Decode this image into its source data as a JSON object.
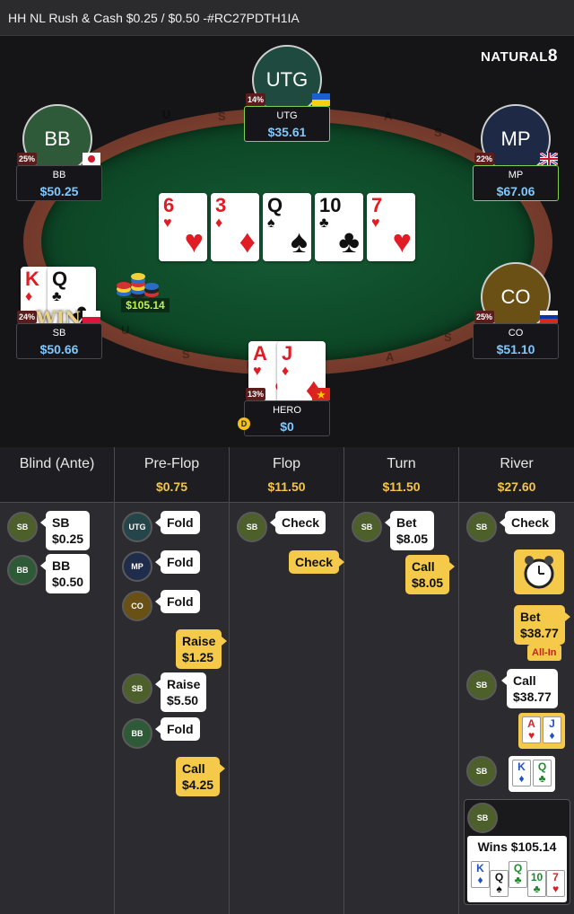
{
  "window": {
    "title": "HH NL Rush & Cash $0.25 / $0.50 -#RC27PDTH1IA"
  },
  "brand": {
    "logo": "NATURAL",
    "logo_digit": "8"
  },
  "board": {
    "cards": [
      {
        "rank": "6",
        "suit": "♥",
        "color": "red"
      },
      {
        "rank": "3",
        "suit": "♦",
        "color": "red"
      },
      {
        "rank": "Q",
        "suit": "♠",
        "color": "black"
      },
      {
        "rank": "10",
        "suit": "♣",
        "color": "black"
      },
      {
        "rank": "7",
        "suit": "♥",
        "color": "red"
      }
    ],
    "pot": "$105.14",
    "rail_letters": [
      "U",
      "S",
      "A",
      "S",
      "U",
      "S",
      "A",
      "S",
      "U"
    ]
  },
  "seats": {
    "utg": {
      "avatar": "UTG",
      "name": "UTG",
      "stack": "$35.61",
      "pct": "14%",
      "flag": "Ukraine",
      "avatar_color": "#1f4a3f"
    },
    "bb": {
      "avatar": "BB",
      "name": "BB",
      "stack": "$50.25",
      "pct": "25%",
      "flag": "Japan",
      "avatar_color": "#2e5a3a"
    },
    "mp": {
      "avatar": "MP",
      "name": "MP",
      "stack": "$67.06",
      "pct": "22%",
      "flag": "United Kingdom",
      "avatar_color": "#1e2a45"
    },
    "sb": {
      "name": "SB",
      "stack": "$50.66",
      "pct": "24%",
      "flag": "Poland",
      "win": "WIN",
      "cards": [
        {
          "rank": "K",
          "suit": "♦",
          "color": "red"
        },
        {
          "rank": "Q",
          "suit": "♣",
          "color": "black"
        }
      ]
    },
    "co": {
      "avatar": "CO",
      "name": "CO",
      "stack": "$51.10",
      "pct": "25%",
      "flag": "Russia",
      "avatar_color": "#6a5014"
    },
    "hero": {
      "name": "HERO",
      "stack": "$0",
      "pct": "13%",
      "flag": "Vietnam",
      "dealer": "D",
      "cards": [
        {
          "rank": "A",
          "suit": "♥",
          "color": "red"
        },
        {
          "rank": "J",
          "suit": "♦",
          "color": "red"
        }
      ]
    }
  },
  "streets": [
    {
      "name": "Blind (Ante)",
      "pot": ""
    },
    {
      "name": "Pre-Flop",
      "pot": "$0.75"
    },
    {
      "name": "Flop",
      "pot": "$11.50"
    },
    {
      "name": "Turn",
      "pot": "$11.50"
    },
    {
      "name": "River",
      "pot": "$27.60"
    }
  ],
  "actions": {
    "blind": [
      {
        "seat": "SB",
        "text1": "SB",
        "text2": "$0.25"
      },
      {
        "seat": "BB",
        "text1": "BB",
        "text2": "$0.50"
      }
    ],
    "preflop": [
      {
        "seat": "UTG",
        "text": "Fold"
      },
      {
        "seat": "MP",
        "text": "Fold"
      },
      {
        "seat": "CO",
        "text": "Fold"
      },
      {
        "hero_text1": "Raise",
        "hero_text2": "$1.25"
      },
      {
        "seat": "SB",
        "text1": "Raise",
        "text2": "$5.50"
      },
      {
        "seat": "BB",
        "text": "Fold"
      },
      {
        "hero_text1": "Call",
        "hero_text2": "$4.25"
      }
    ],
    "flop": [
      {
        "seat": "SB",
        "text": "Check"
      },
      {
        "hero_text": "Check"
      }
    ],
    "turn": [
      {
        "seat": "SB",
        "text1": "Bet",
        "text2": "$8.05"
      },
      {
        "hero_text1": "Call",
        "hero_text2": "$8.05"
      }
    ],
    "river": {
      "sb_check": "Check",
      "hero_bet1": "Bet",
      "hero_bet2": "$38.77",
      "allin": "All-In",
      "sb_call1": "Call",
      "sb_call2": "$38.77",
      "hero_show": [
        {
          "rank": "A",
          "suit": "♥",
          "color": "red"
        },
        {
          "rank": "J",
          "suit": "♦",
          "color": "red"
        }
      ],
      "sb_show": [
        {
          "rank": "K",
          "suit": "♦",
          "color": "blue"
        },
        {
          "rank": "Q",
          "suit": "♣",
          "color": "green"
        }
      ],
      "wins": "Wins $105.14",
      "win_hand": [
        {
          "rank": "K",
          "suit": "♦",
          "color": "blue"
        },
        {
          "rank": "Q",
          "suit": "♠",
          "color": "black"
        },
        {
          "rank": "Q",
          "suit": "♣",
          "color": "green"
        },
        {
          "rank": "10",
          "suit": "♣",
          "color": "green"
        },
        {
          "rank": "7",
          "suit": "♥",
          "color": "red"
        }
      ]
    }
  },
  "seat_labels": {
    "sb": "SB",
    "bb": "BB",
    "utg": "UTG",
    "mp": "MP",
    "co": "CO"
  },
  "colors": {
    "sb_chip": "#4d5f2a",
    "bb_chip": "#2f5a38",
    "utg_chip": "#24454a",
    "mp_chip": "#1f2c4c",
    "co_chip": "#6a5014",
    "accent_yellow": "#f5c94a",
    "stack_blue": "#7fc8ff"
  }
}
